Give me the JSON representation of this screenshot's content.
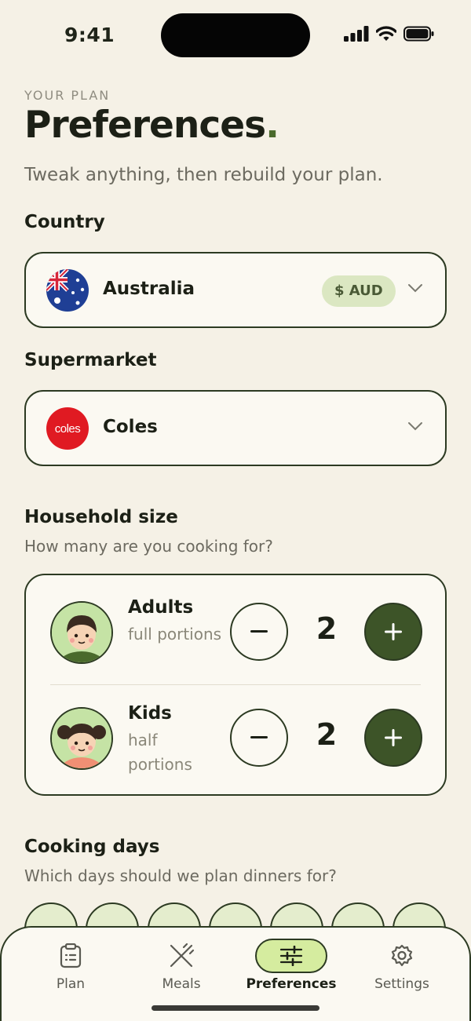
{
  "status_bar": {
    "time": "9:41"
  },
  "header": {
    "eyebrow": "YOUR PLAN",
    "title": "Preferences",
    "title_dot": ".",
    "subtitle": "Tweak anything, then rebuild your plan."
  },
  "country": {
    "label": "Country",
    "value": "Australia",
    "currency": "$ AUD",
    "icon": "australia-flag-icon"
  },
  "supermarket": {
    "label": "Supermarket",
    "value": "Coles",
    "logo_text": "coles",
    "logo_color": "#e01a22"
  },
  "household": {
    "label": "Household size",
    "help": "How many are you cooking for?",
    "rows": [
      {
        "title": "Adults",
        "subtitle": "full portions",
        "value": "2"
      },
      {
        "title": "Kids",
        "subtitle": "half portions",
        "value": "2"
      }
    ]
  },
  "cooking_days": {
    "label": "Cooking days",
    "help": "Which days should we plan dinners for?"
  },
  "tabs": [
    {
      "label": "Plan",
      "icon": "clipboard-icon"
    },
    {
      "label": "Meals",
      "icon": "fork-knife-icon"
    },
    {
      "label": "Preferences",
      "icon": "sliders-icon",
      "active": true
    },
    {
      "label": "Settings",
      "icon": "gear-icon"
    }
  ],
  "colors": {
    "background": "#f5f1e6",
    "accent_dark": "#3d5428",
    "accent_light": "#d5ec9f",
    "pill": "#dbe7c2"
  }
}
